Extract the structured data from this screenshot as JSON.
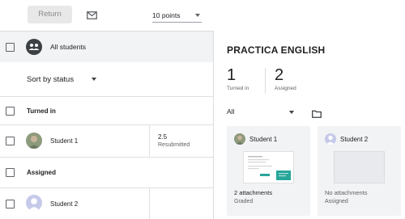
{
  "toolbar": {
    "return_label": "Return",
    "points_value": "10 points"
  },
  "roster": {
    "all_students_label": "All students",
    "sort_label": "Sort by status",
    "sections": [
      {
        "label": "Turned in",
        "students": [
          {
            "name": "Student 1",
            "grade": "2.5",
            "status": "Resubmitted"
          }
        ]
      },
      {
        "label": "Assigned",
        "students": [
          {
            "name": "Student 2",
            "grade": "",
            "status": ""
          }
        ]
      }
    ]
  },
  "assignment": {
    "title": "PRACTICA ENGLISH",
    "stats": [
      {
        "count": "1",
        "label": "Turned in"
      },
      {
        "count": "2",
        "label": "Assigned"
      }
    ],
    "filter_value": "All",
    "cards": [
      {
        "name": "Student 1",
        "attachments": "2 attachments",
        "status": "Graded"
      },
      {
        "name": "Student 2",
        "attachments": "No attachments",
        "status": "Assigned"
      }
    ]
  },
  "colors": {
    "accent_teal": "#26a69a",
    "muted_text": "#5f6368",
    "card_bg": "#f1f3f4"
  },
  "icons": [
    "mail-icon",
    "group-icon",
    "chevron-down-icon",
    "folder-icon",
    "person-icon"
  ]
}
